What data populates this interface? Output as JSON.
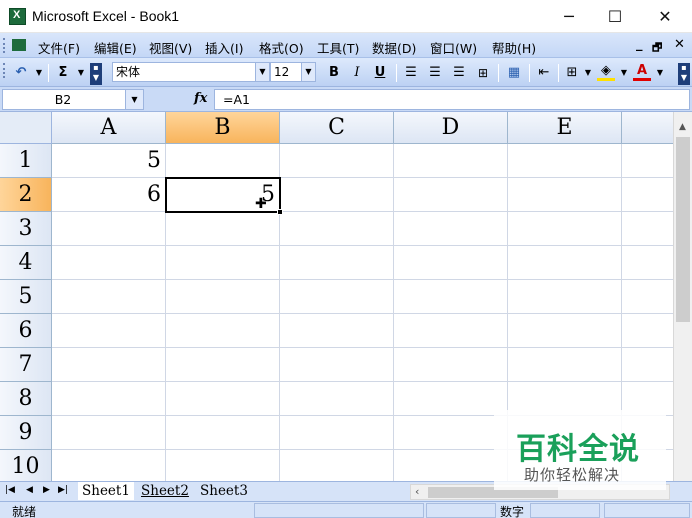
{
  "window": {
    "title": "Microsoft Excel - Book1",
    "minimize_glyph": "─",
    "maximize_glyph": "☐",
    "close_glyph": "✕"
  },
  "menu": {
    "items": [
      "文件(F)",
      "编辑(E)",
      "视图(V)",
      "插入(I)",
      "格式(O)",
      "工具(T)",
      "数据(D)",
      "窗口(W)",
      "帮助(H)"
    ],
    "mdi_min": "_",
    "mdi_restore": "🗗",
    "mdi_close": "✕"
  },
  "toolbar": {
    "undo_glyph": "↶",
    "sum_glyph": "Σ",
    "font_name": "宋体",
    "font_size": "12",
    "bold": "B",
    "italic": "I",
    "underline": "U",
    "font_color_glyph": "A"
  },
  "formula_bar": {
    "name_box": "B2",
    "fx_label": "fx",
    "formula": "=A1"
  },
  "sheet": {
    "columns": [
      "A",
      "B",
      "C",
      "D",
      "E"
    ],
    "rows": [
      "1",
      "2",
      "3",
      "4",
      "5",
      "6",
      "7",
      "8",
      "9",
      "10"
    ],
    "active_cell": "B2",
    "cells": {
      "A1": "5",
      "A2": "6",
      "B2": "5"
    }
  },
  "tabs": [
    "Sheet1",
    "Sheet2",
    "Sheet3"
  ],
  "status": {
    "ready": "就绪",
    "num_lock": "数字"
  },
  "watermark": {
    "title": "百科全说",
    "subtitle": "助你轻松解决"
  },
  "colors": {
    "active_header": "#f8b45c",
    "toolbar_blue": "#c4d7f6",
    "watermark_green": "#1aa05a"
  }
}
